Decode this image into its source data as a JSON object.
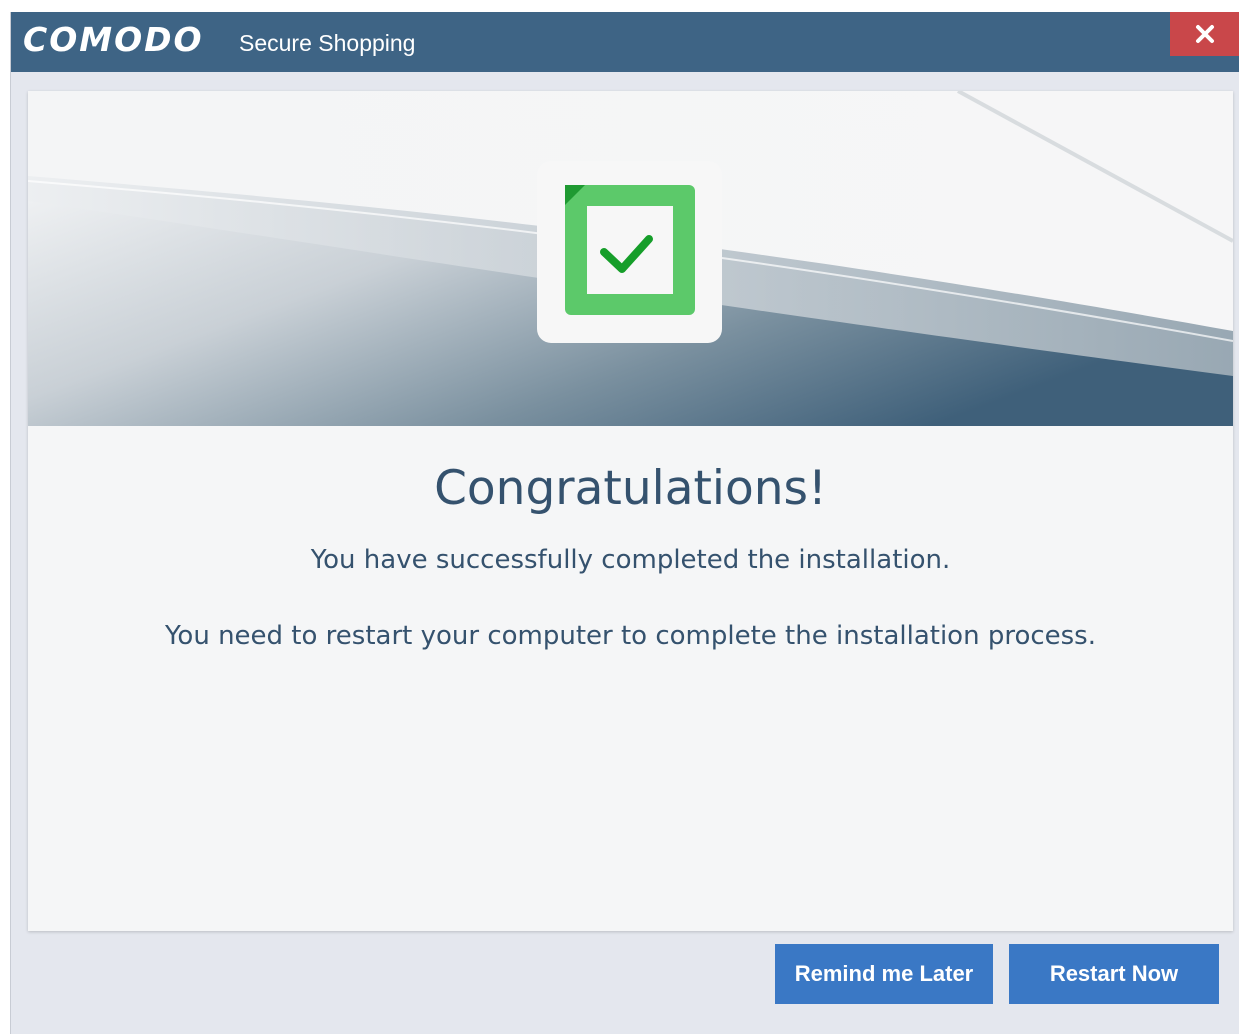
{
  "window": {
    "brand": "COMODO",
    "product": "Secure Shopping",
    "close_icon": "close-icon"
  },
  "content": {
    "heading": "Congratulations!",
    "message_success": "You have successfully completed the installation.",
    "message_restart": "You need to restart your computer to complete the installation process.",
    "status_icon": "checkmark-icon"
  },
  "buttons": {
    "remind_label": "Remind me Later",
    "restart_label": "Restart Now"
  },
  "colors": {
    "titlebar": "#3e6485",
    "close": "#c9474a",
    "accent_button": "#3a78c5",
    "success_green": "#5cc96a",
    "check_green": "#169e2a",
    "text": "#35526e"
  }
}
